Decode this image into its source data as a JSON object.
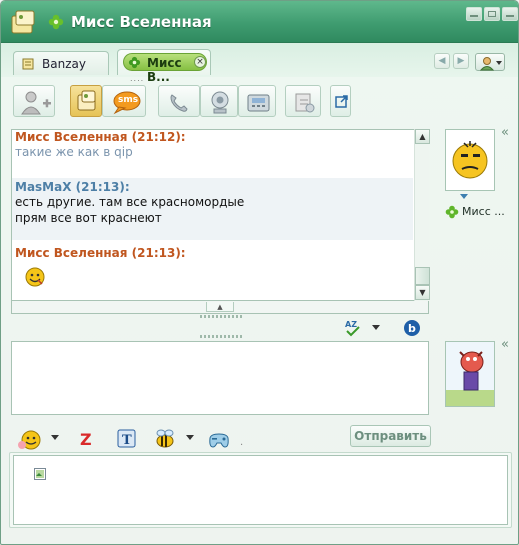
{
  "window": {
    "title": "Мисс Вселенная",
    "accent": "#3f9c70"
  },
  "tabs": [
    {
      "label": "Banzay",
      "active": false
    },
    {
      "label": "Мисс В...",
      "active": true
    }
  ],
  "typing_indicator": "....",
  "toolbar": {
    "sms_label": "sms"
  },
  "chat": {
    "messages": [
      {
        "sender": "Мисс Вселенная (21:12):",
        "lines": [
          "такие же как в qip"
        ],
        "from_me": false
      },
      {
        "sender": "MasMaX (21:13):",
        "lines": [
          "есть другие. там все красномордые",
          "прям все вот краснеют"
        ],
        "from_me": true
      },
      {
        "sender": "Мисс Вселенная (21:13):",
        "lines": [],
        "emoticon": "smiley-icon",
        "from_me": false
      }
    ]
  },
  "buddy": {
    "name": "Мисс ..."
  },
  "composer": {
    "value": "",
    "send_label": "Отправить"
  }
}
